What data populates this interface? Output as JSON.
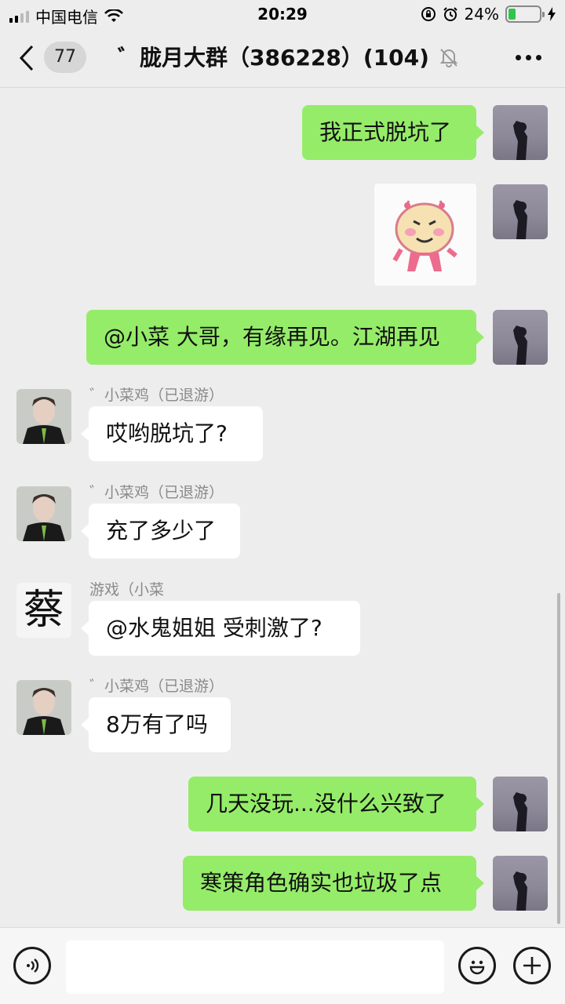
{
  "status_bar": {
    "carrier": "中国电信",
    "time": "20:29",
    "battery_percent": "24%",
    "battery_level": 0.24,
    "icons": [
      "signal-icon",
      "wifi-icon",
      "rotation-lock-icon",
      "alarm-icon",
      "battery-icon",
      "charging-icon"
    ]
  },
  "nav": {
    "unread_count": "77",
    "title": "゛胧月大群（386228）(104)",
    "icons": [
      "back-chevron-icon",
      "mute-bell-icon",
      "more-dots-icon"
    ]
  },
  "messages": [
    {
      "side": "out",
      "text": "我正式脱坑了"
    },
    {
      "side": "out",
      "type": "sticker",
      "sticker_icon": "pink-monster-sticker"
    },
    {
      "side": "out",
      "text": "@小菜 大哥，有缘再见。江湖再见"
    },
    {
      "side": "in",
      "sender": "゛小菜鸡（已退游）",
      "text": "哎哟脱坑了?"
    },
    {
      "side": "in",
      "sender": "゛小菜鸡（已退游）",
      "text": "充了多少了"
    },
    {
      "side": "in",
      "sender": "游戏（小菜",
      "text": "@水鬼姐姐 受刺激了?",
      "avatar_char": "蔡"
    },
    {
      "side": "in",
      "sender": "゛小菜鸡（已退游）",
      "text": "8万有了吗"
    },
    {
      "side": "out",
      "text": "几天没玩...没什么兴致了"
    },
    {
      "side": "out",
      "text": "寒策角色确实也垃圾了点"
    }
  ],
  "input_bar": {
    "placeholder": "",
    "icons": [
      "voice-icon",
      "emoji-icon",
      "plus-icon"
    ]
  },
  "colors": {
    "background": "#ededed",
    "outgoing_bubble": "#95ec69",
    "incoming_bubble": "#ffffff",
    "sender_name": "#8a8a8a",
    "battery_fill": "#2fc54a"
  }
}
